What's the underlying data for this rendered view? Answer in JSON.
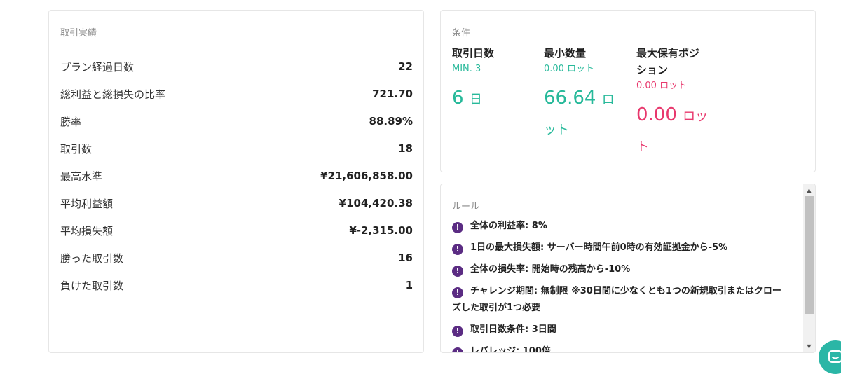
{
  "stats": {
    "title": "取引実績",
    "rows": [
      {
        "label": "プラン経過日数",
        "value": "22"
      },
      {
        "label": "総利益と総損失の比率",
        "value": "721.70"
      },
      {
        "label": "勝率",
        "value": "88.89%"
      },
      {
        "label": "取引数",
        "value": "18"
      },
      {
        "label": "最高水準",
        "value": "¥21,606,858.00"
      },
      {
        "label": "平均利益額",
        "value": "¥104,420.38"
      },
      {
        "label": "平均損失額",
        "value": "¥-2,315.00"
      },
      {
        "label": "勝った取引数",
        "value": "16"
      },
      {
        "label": "負けた取引数",
        "value": "1"
      }
    ]
  },
  "conditions": {
    "title": "条件",
    "items": [
      {
        "title": "取引日数",
        "sub": "MIN. 3",
        "value": "6",
        "unit": "日"
      },
      {
        "title": "最小数量",
        "sub": "0.00 ロット",
        "value": "66.64",
        "unit": "ロ",
        "unit2": "ット"
      },
      {
        "title_line1": "最大保有ポジ",
        "title_line2": "ション",
        "sub": "0.00 ロット",
        "value": "0.00",
        "unit": "ロッ",
        "unit2": "ト"
      }
    ]
  },
  "rules": {
    "title": "ルール",
    "icon": "!",
    "items": [
      {
        "text": "全体の利益率: 8%"
      },
      {
        "text": "1日の最大損失額: サーバー時間午前0時の有効証拠金から-5%"
      },
      {
        "text": "全体の損失率: 開始時の残高から-10%"
      },
      {
        "text": "チャレンジ期間: 無制限 ※30日間に少なくとも1つの新規取引またはクロー",
        "text2": "ズした取引が1つ必要"
      },
      {
        "text": "取引日数条件: 3日間"
      },
      {
        "text": "レバレッジ: 100倍"
      }
    ]
  },
  "colors": {
    "green": "#27b99a",
    "pink": "#e8386d",
    "rule_icon": "#5b2c83",
    "chat": "#2bb6a6"
  }
}
